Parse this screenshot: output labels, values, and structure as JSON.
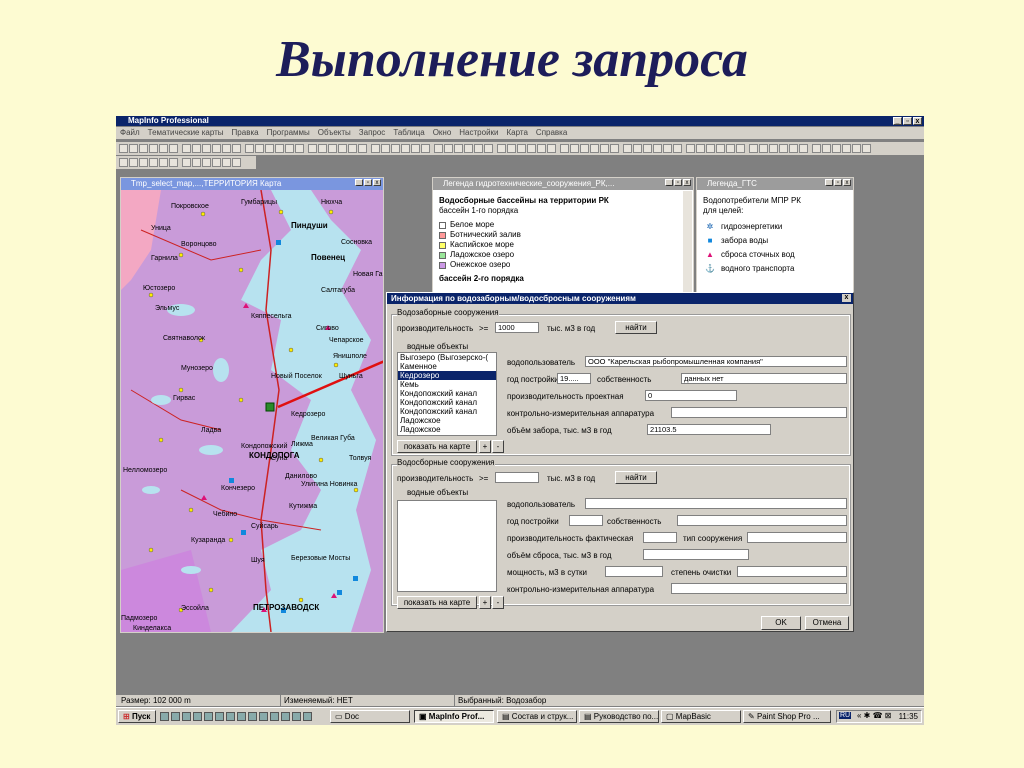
{
  "slide": {
    "title": "Выполнение запроса"
  },
  "app": {
    "title": "MapInfo Professional",
    "window_buttons": [
      "_",
      "▫",
      "x"
    ],
    "menu": [
      "Файл",
      "Тематические карты",
      "Правка",
      "Программы",
      "Объекты",
      "Запрос",
      "Таблица",
      "Окно",
      "Настройки",
      "Карта",
      "Справка"
    ]
  },
  "map_window": {
    "title": "Tmp_select_map,...,ТЕРРИТОРИЯ Карта",
    "labels": [
      "Покровское",
      "Гумбарицы",
      "Нюхча",
      "Пиндуши",
      "Сосновка",
      "Повенец",
      "Новая Габсельга",
      "Воронцово",
      "Юстозеро",
      "Эльмус",
      "Кяппесельга",
      "Сигово",
      "Чепарское",
      "Янишполе",
      "Кедрозеро",
      "Святнаволок",
      "Новый Поселок",
      "Шуньга",
      "Гирвас",
      "Кондопожский",
      "Суна",
      "Великая Губа",
      "Толвуя",
      "Шуя",
      "Березовые Мосты",
      "Кузаранда",
      "Уница",
      "Лижма",
      "КОНДОПОГА",
      "ПЕТРОЗАВОДСК",
      "Падмозеро",
      "Кончезеро",
      "Нелломозеро",
      "Мунозеро",
      "Ладва",
      "Кинделакса",
      "Гарнила",
      "Салтагуба",
      "Данилово",
      "Улитина Новинка",
      "Кутижма",
      "Суйсарь",
      "Чебино",
      "Эссойла"
    ],
    "scale_note": ""
  },
  "legend_rk": {
    "title": "Легенда гидротехнические_сооружения_РК,...",
    "heading": "Водосборные бассейны на территории РК",
    "subheading": "бассейн 1-го порядка",
    "items": [
      {
        "label": "Белое море",
        "color": "#ffffff"
      },
      {
        "label": "Ботнический залив",
        "color": "#ff9999"
      },
      {
        "label": "Каспийское море",
        "color": "#ffff66"
      },
      {
        "label": "Ладожское озеро",
        "color": "#99e699"
      },
      {
        "label": "Онежское озеро",
        "color": "#cc99e6"
      }
    ],
    "more": "бассейн 2-го порядка"
  },
  "legend_gts": {
    "title": "Легенда_ГТС",
    "heading": "Водопотребители МПР РК",
    "subheading": "для целей:",
    "items": [
      {
        "label": "гидроэнергетики",
        "icon": "gear-icon",
        "color": "#0055aa"
      },
      {
        "label": "забора воды",
        "icon": "square-icon",
        "color": "#1188dd"
      },
      {
        "label": "сброса сточных вод",
        "icon": "triangle-icon",
        "color": "#dd1177"
      },
      {
        "label": "водного транспорта",
        "icon": "anchor-icon",
        "color": "#333333"
      }
    ]
  },
  "dialog": {
    "title": "Информация по водозаборным/водосбросным сооружениям",
    "close": "x",
    "intake": {
      "group_title": "Водозаборные сооружения",
      "capacity_label": "производительность",
      "op": ">=",
      "capacity_value": "1000",
      "unit": "тыс. м3 в год",
      "find_button": "найти",
      "water_objects_label": "водные объекты",
      "list": [
        "Выгозеро (Выгозерско-(",
        "Каменное",
        "Кедрозеро",
        "Кемь",
        "Кондопожский канал",
        "Кондопожский канал",
        "Кондопожский канал",
        "Ладожское",
        "Ладожское"
      ],
      "selected_index": 2,
      "show_on_map": "показать на карте",
      "plus": "+",
      "minus": "-",
      "user_label": "водопользователь",
      "user_value": "ООО \"Карельская рыбопромышленная компания\"",
      "year_label": "год постройки",
      "year_value": "19.....",
      "ownership_label": "собственность",
      "ownership_value": "данных нет",
      "design_capacity_label": "производительность проектная",
      "design_capacity_value": "0",
      "equipment_label": "контрольно-измерительная аппаратура",
      "equipment_value": "",
      "volume_label": "объём забора, тыс. м3 в год",
      "volume_value": "21103.5"
    },
    "discharge": {
      "group_title": "Водосборные сооружения",
      "capacity_label": "производительность",
      "op": ">=",
      "capacity_value": "",
      "unit": "тыс. м3 в год",
      "find_button": "найти",
      "water_objects_label": "водные объекты",
      "show_on_map": "показать на карте",
      "plus": "+",
      "minus": "-",
      "user_label": "водопользователь",
      "year_label": "год постройки",
      "ownership_label": "собственность",
      "actual_capacity_label": "производительность фактическая",
      "type_label": "тип сооружения",
      "volume_label": "объём сброса, тыс. м3 в год",
      "power_label": "мощность, м3 в сутки",
      "purification_label": "степень очистки",
      "equipment_label": "контрольно-измерительная аппаратура"
    },
    "ok": "OK",
    "cancel": "Отмена"
  },
  "status": {
    "size": "Размер: 102 000 m",
    "editable": "Изменяемый: НЕТ",
    "selected": "Выбранный: Водозабор"
  },
  "taskbar": {
    "start": "Пуск",
    "tasks": [
      "Doc",
      "MapInfo Prof...",
      "Состав и струк...",
      "Руководство по...",
      "MapBasic",
      "Paint Shop Pro ..."
    ],
    "tray_lang": "RU",
    "time": "11:35"
  }
}
